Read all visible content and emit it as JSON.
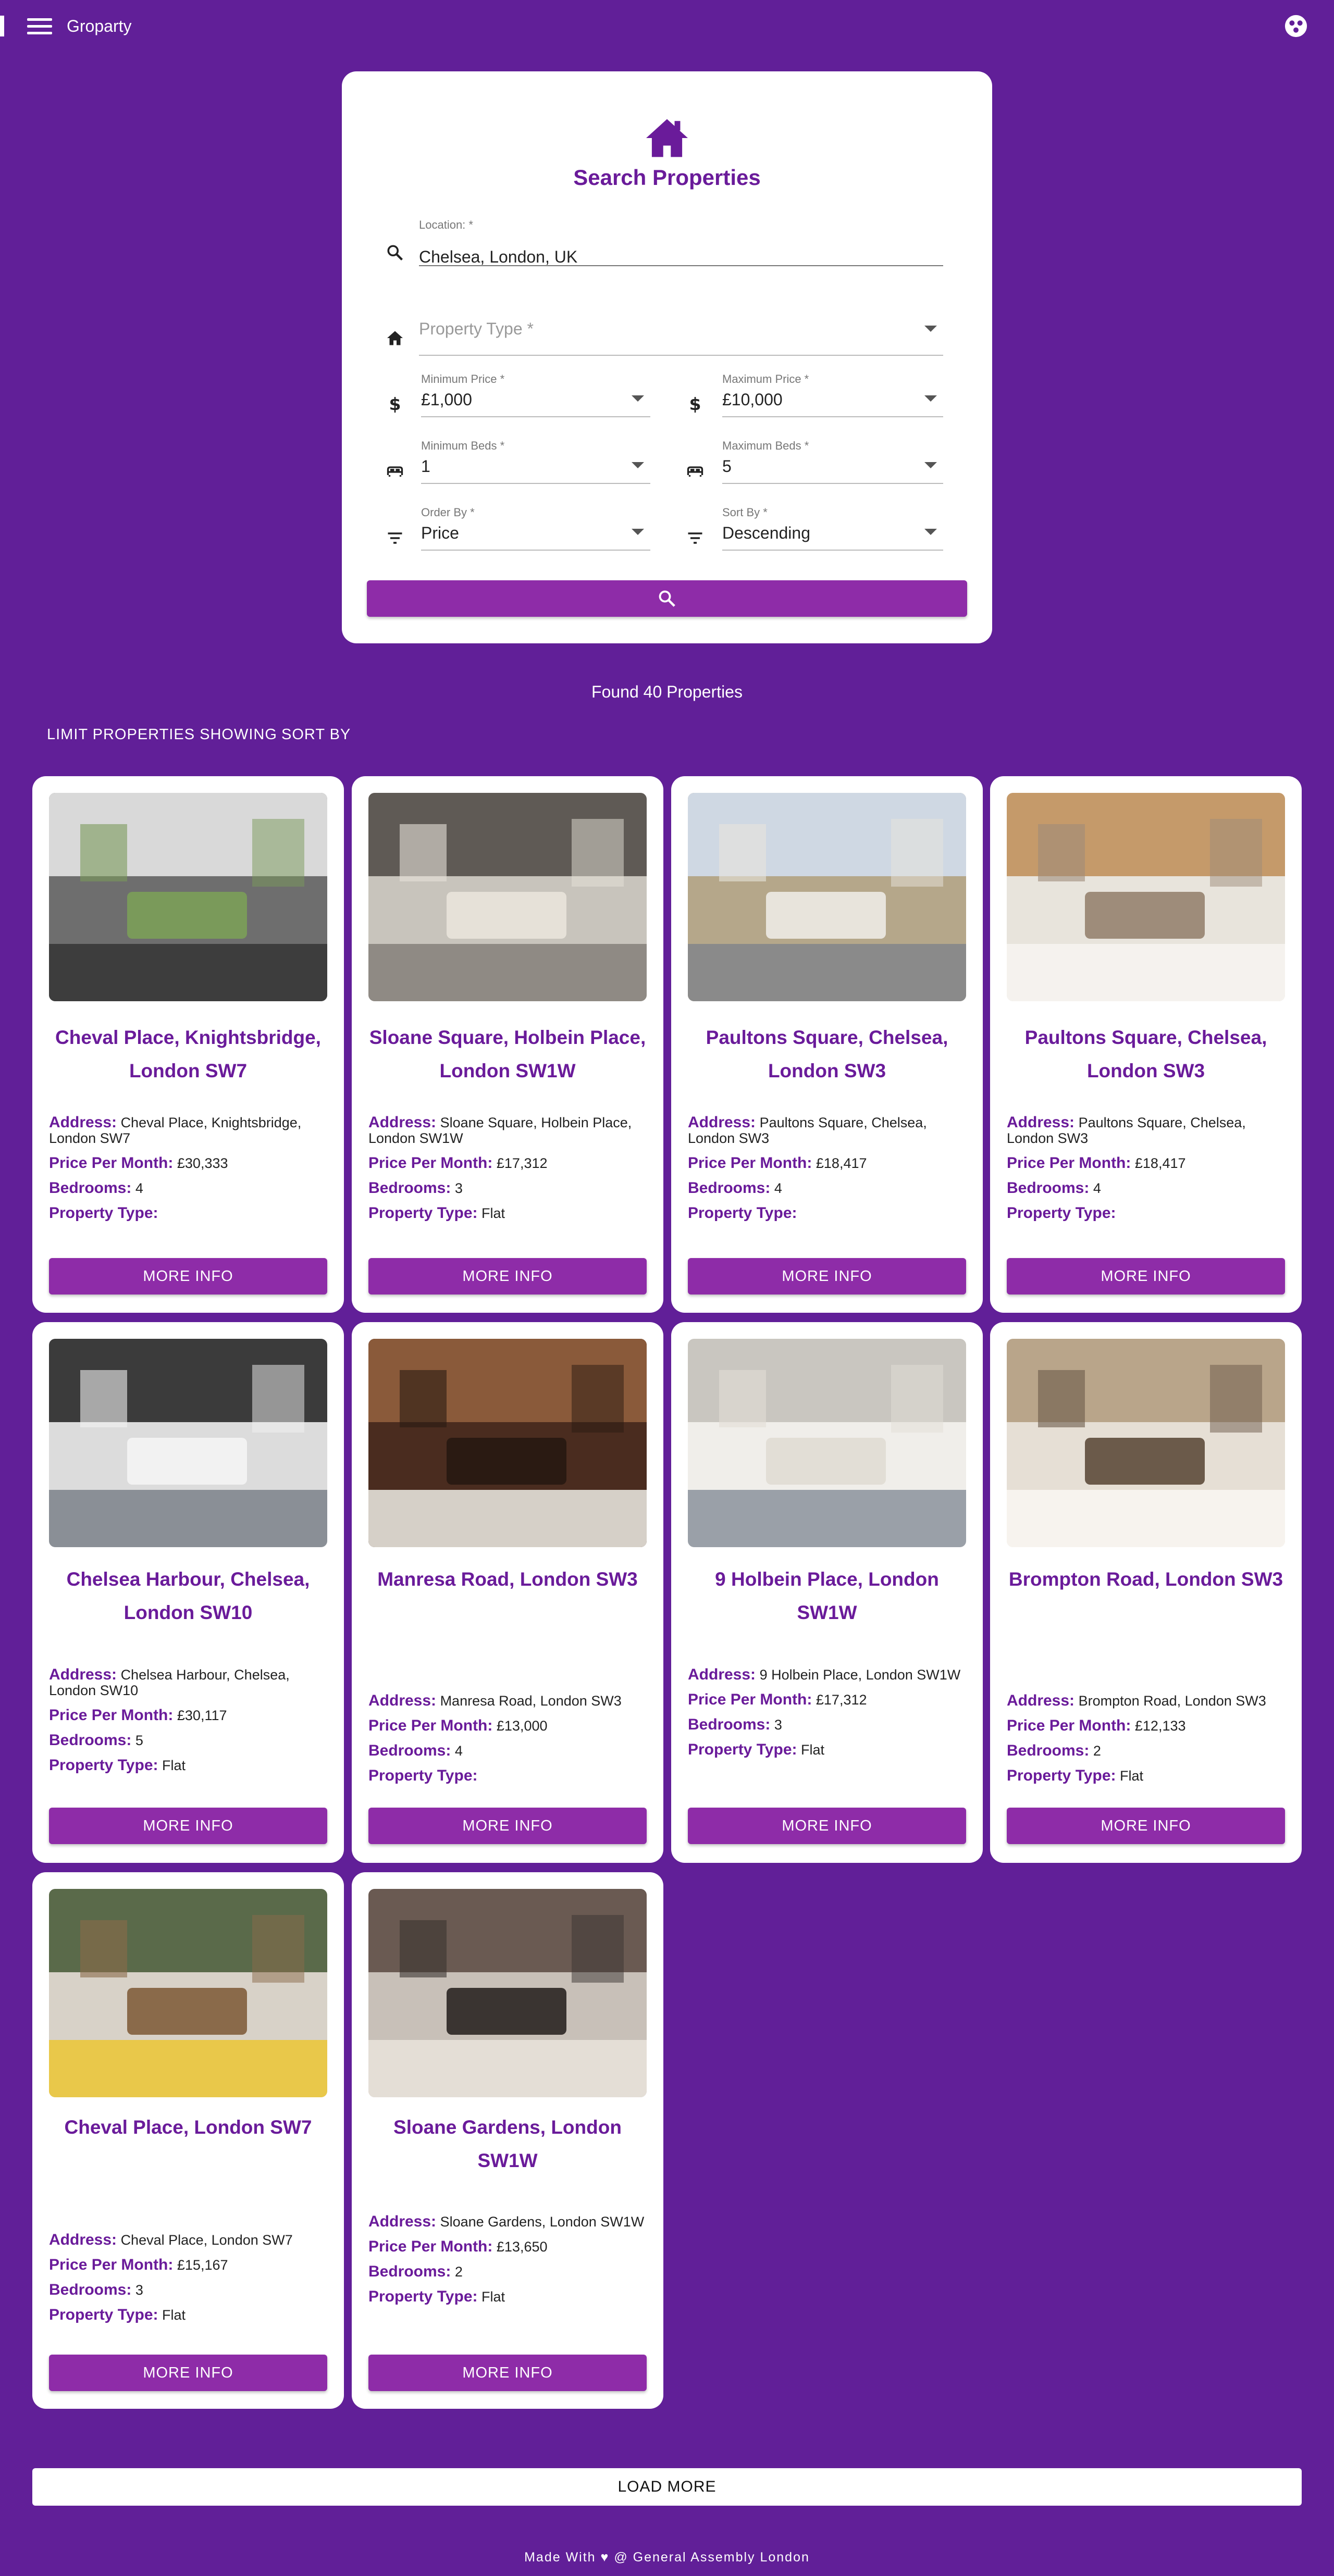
{
  "app": {
    "title": "Groparty"
  },
  "search": {
    "title": "Search Properties",
    "location_label": "Location: *",
    "location_value": "Chelsea, London, UK",
    "property_type_placeholder": "Property Type *",
    "min_price_label": "Minimum Price *",
    "min_price_value": "£1,000",
    "max_price_label": "Maximum Price *",
    "max_price_value": "£10,000",
    "min_beds_label": "Minimum Beds *",
    "min_beds_value": "1",
    "max_beds_label": "Maximum Beds *",
    "max_beds_value": "5",
    "order_by_label": "Order By *",
    "order_by_value": "Price",
    "sort_by_label": "Sort By *",
    "sort_by_value": "Descending"
  },
  "results": {
    "found_text": "Found 40 Properties",
    "limit_label": "LIMIT PROPERTIES SHOWING",
    "sort_label": "SORT BY"
  },
  "labels": {
    "address": "Address:",
    "price": "Price Per Month:",
    "bedrooms": "Bedrooms:",
    "type": "Property Type:",
    "more_info": "MORE INFO"
  },
  "properties": [
    {
      "title": "Cheval Place, Knightsbridge, London SW7",
      "address": "Cheval Place, Knightsbridge, London SW7",
      "price": "£30,333",
      "bedrooms": "4",
      "type": ""
    },
    {
      "title": "Sloane Square, Holbein Place, London SW1W",
      "address": "Sloane Square, Holbein Place, London SW1W",
      "price": "£17,312",
      "bedrooms": "3",
      "type": "Flat"
    },
    {
      "title": "Paultons Square, Chelsea, London SW3",
      "address": "Paultons Square, Chelsea, London SW3",
      "price": "£18,417",
      "bedrooms": "4",
      "type": ""
    },
    {
      "title": "Paultons Square, Chelsea, London SW3",
      "address": "Paultons Square, Chelsea, London SW3",
      "price": "£18,417",
      "bedrooms": "4",
      "type": ""
    },
    {
      "title": "Chelsea Harbour, Chelsea, London SW10",
      "address": "Chelsea Harbour, Chelsea, London SW10",
      "price": "£30,117",
      "bedrooms": "5",
      "type": "Flat"
    },
    {
      "title": "Manresa Road, London SW3",
      "address": "Manresa Road, London SW3",
      "price": "£13,000",
      "bedrooms": "4",
      "type": ""
    },
    {
      "title": "9 Holbein Place, London SW1W",
      "address": "9 Holbein Place, London SW1W",
      "price": "£17,312",
      "bedrooms": "3",
      "type": "Flat"
    },
    {
      "title": "Brompton Road, London SW3",
      "address": "Brompton Road, London SW3",
      "price": "£12,133",
      "bedrooms": "2",
      "type": "Flat"
    },
    {
      "title": "Cheval Place, London SW7",
      "address": "Cheval Place, London SW7",
      "price": "£15,167",
      "bedrooms": "3",
      "type": "Flat"
    },
    {
      "title": "Sloane Gardens, London SW1W",
      "address": "Sloane Gardens, London SW1W",
      "price": "£13,650",
      "bedrooms": "2",
      "type": "Flat"
    }
  ],
  "load_more": "LOAD MORE",
  "footer": {
    "made_with": "Made With",
    "heart": "♥",
    "credit": "@ General Assembly London"
  },
  "colors": {
    "background": "#611f98",
    "accent": "#8e2ca8",
    "title": "#6a1b9a"
  }
}
